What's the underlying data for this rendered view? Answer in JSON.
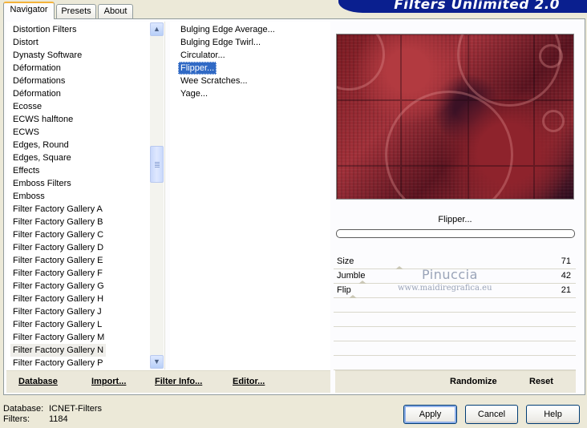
{
  "tabs": [
    {
      "label": "Navigator",
      "active": true
    },
    {
      "label": "Presets",
      "active": false
    },
    {
      "label": "About",
      "active": false
    }
  ],
  "banner": "Filters Unlimited 2.0",
  "categories": [
    "Distortion Filters",
    "Distort",
    "Dynasty Software",
    "Déformation",
    "Déformations",
    "Déformation",
    "Ecosse",
    "ECWS halftone",
    "ECWS",
    "Edges, Round",
    "Edges, Square",
    "Effects",
    "Emboss Filters",
    "Emboss",
    "Filter Factory Gallery A",
    "Filter Factory Gallery B",
    "Filter Factory Gallery C",
    "Filter Factory Gallery D",
    "Filter Factory Gallery E",
    "Filter Factory Gallery F",
    "Filter Factory Gallery G",
    "Filter Factory Gallery H",
    "Filter Factory Gallery J",
    "Filter Factory Gallery L",
    "Filter Factory Gallery M",
    "Filter Factory Gallery N",
    "Filter Factory Gallery P"
  ],
  "selected_category": "Filter Factory Gallery N",
  "filters": [
    "Bulging Edge Average...",
    "Bulging Edge Twirl...",
    "Circulator...",
    "Flipper...",
    "Wee Scratches...",
    "Yage..."
  ],
  "selected_filter": "Flipper...",
  "filter_title": "Flipper...",
  "parameters": [
    {
      "name": "Size",
      "value": "71"
    },
    {
      "name": "Jumble",
      "value": "42"
    },
    {
      "name": "Flip",
      "value": "21"
    }
  ],
  "watermark": {
    "line1": "Pinuccia",
    "line2": "www.maidiregrafica.eu"
  },
  "links": {
    "database": "Database",
    "import": "Import...",
    "filter_info": "Filter Info...",
    "editor": "Editor...",
    "randomize": "Randomize",
    "reset": "Reset"
  },
  "status": {
    "database_label": "Database:",
    "database_value": "ICNET-Filters",
    "filters_label": "Filters:",
    "filters_value": "1184"
  },
  "buttons": {
    "apply": "Apply",
    "cancel": "Cancel",
    "help": "Help"
  }
}
